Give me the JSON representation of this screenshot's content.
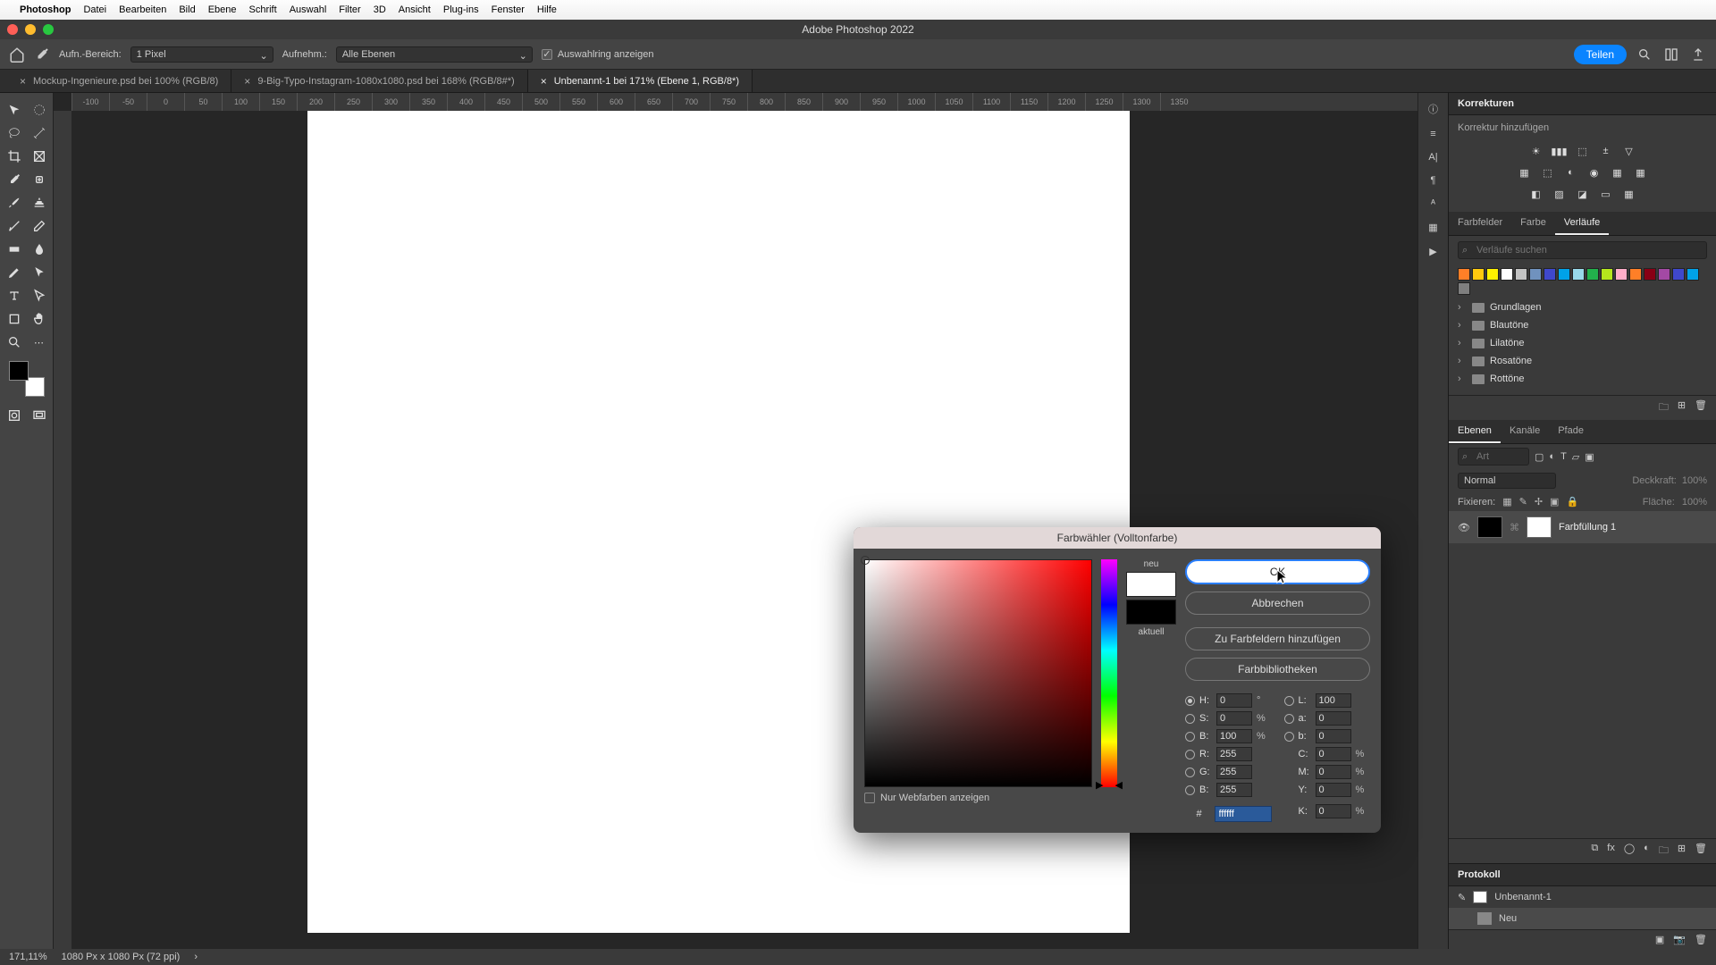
{
  "mac_menu": {
    "app": "Photoshop",
    "items": [
      "Datei",
      "Bearbeiten",
      "Bild",
      "Ebene",
      "Schrift",
      "Auswahl",
      "Filter",
      "3D",
      "Ansicht",
      "Plug-ins",
      "Fenster",
      "Hilfe"
    ]
  },
  "window": {
    "title": "Adobe Photoshop 2022"
  },
  "options_bar": {
    "sample_area_label": "Aufn.-Bereich:",
    "sample_area_value": "1 Pixel",
    "sample_from_label": "Aufnehm.:",
    "sample_from_value": "Alle Ebenen",
    "show_ring_label": "Auswahlring anzeigen",
    "share_label": "Teilen"
  },
  "tabs": [
    {
      "label": "Mockup-Ingenieure.psd bei 100% (RGB/8)",
      "active": false
    },
    {
      "label": "9-Big-Typo-Instagram-1080x1080.psd bei 168% (RGB/8#*)",
      "active": false
    },
    {
      "label": "Unbenannt-1 bei 171% (Ebene 1, RGB/8*)",
      "active": true
    }
  ],
  "ruler_ticks": [
    "-100",
    "-50",
    "0",
    "50",
    "100",
    "150",
    "200",
    "250",
    "300",
    "350",
    "400",
    "450",
    "500",
    "550",
    "600",
    "650",
    "700",
    "750",
    "800",
    "850",
    "900",
    "950",
    "1000",
    "1050",
    "1100",
    "1150",
    "1200",
    "1250",
    "1300",
    "1350"
  ],
  "panels": {
    "corrections": {
      "title": "Korrekturen",
      "add_label": "Korrektur hinzufügen"
    },
    "swatch_tabs": {
      "swatches": "Farbfelder",
      "color": "Farbe",
      "gradients": "Verläufe"
    },
    "gradients": {
      "search_placeholder": "Verläufe suchen",
      "folders": [
        "Grundlagen",
        "Blautöne",
        "Lilatöne",
        "Rosatöne",
        "Rottöne"
      ]
    },
    "layers_tabs": {
      "layers": "Ebenen",
      "channels": "Kanäle",
      "paths": "Pfade"
    },
    "layers": {
      "search_placeholder": "Art",
      "blend_mode": "Normal",
      "opacity_label": "Deckkraft:",
      "opacity_value": "100%",
      "lock_label": "Fixieren:",
      "fill_label": "Fläche:",
      "fill_value": "100%",
      "layer0_name": "Farbfüllung 1"
    },
    "protocol": {
      "title": "Protokoll",
      "items": [
        {
          "label": "Unbenannt-1"
        },
        {
          "label": "Neu"
        }
      ]
    }
  },
  "color_picker": {
    "title": "Farbwähler (Volltonfarbe)",
    "new_label": "neu",
    "current_label": "aktuell",
    "ok": "OK",
    "cancel": "Abbrechen",
    "add_swatch": "Zu Farbfeldern hinzufügen",
    "libraries": "Farbbibliotheken",
    "web_only": "Nur Webfarben anzeigen",
    "values": {
      "H": "0",
      "S": "0",
      "B": "100",
      "R": "255",
      "G": "255",
      "Bl": "255",
      "L": "100",
      "a": "0",
      "b_lab": "0",
      "C": "0",
      "M": "0",
      "Y": "0",
      "K": "0",
      "hex": "ffffff"
    }
  },
  "status": {
    "zoom": "171,11%",
    "dims": "1080 Px x 1080 Px (72 ppi)"
  },
  "colors": {
    "swatches": [
      "#ff7f27",
      "#ffc90e",
      "#fff200",
      "#ffffff",
      "#c3c3c3",
      "#7092be",
      "#3f48cc",
      "#00a2e8",
      "#99d9ea",
      "#22b14c",
      "#b5e61d",
      "#ffaec9",
      "#ff7f27",
      "#880015",
      "#a349a4",
      "#3f48cc",
      "#00a2e8",
      "#7f7f7f"
    ]
  }
}
